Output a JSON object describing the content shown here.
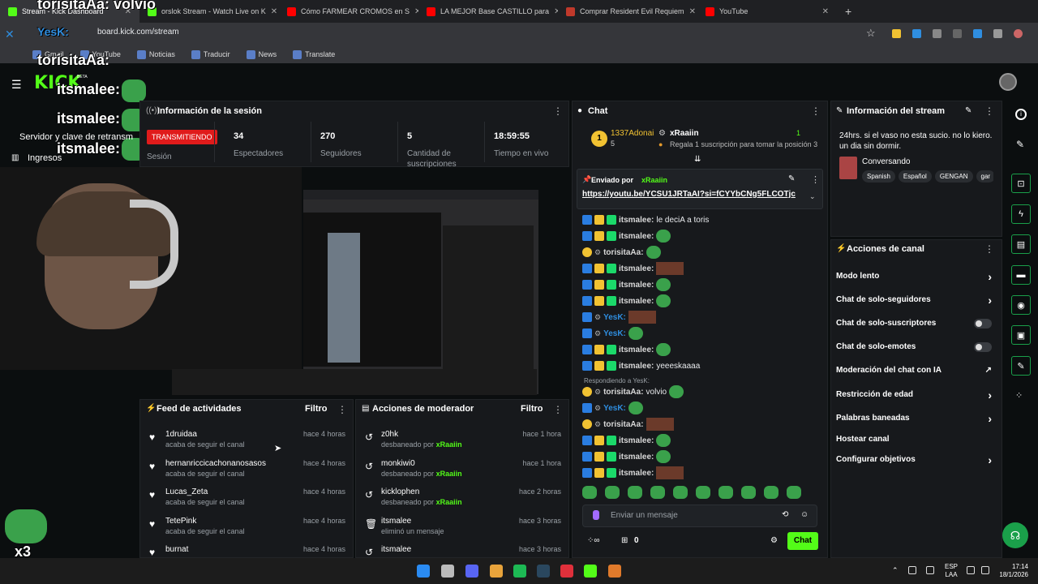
{
  "browser": {
    "tabs": [
      {
        "label": "Stream - Kick Dashboard",
        "color": "#53fc18",
        "active": true
      },
      {
        "label": "orslok Stream - Watch Live on K",
        "color": "#53fc18"
      },
      {
        "label": "Cómo FARMEAR CROMOS en S",
        "color": "#ff0000"
      },
      {
        "label": "LA MEJOR Base CASTILLO para",
        "color": "#ff0000"
      },
      {
        "label": "Comprar Resident Evil Requiem",
        "color": "#c0392b"
      },
      {
        "label": "YouTube",
        "color": "#ff0000"
      }
    ],
    "url": "board.kick.com/stream",
    "bookmarks": [
      "Gmail",
      "YouTube",
      "Noticias",
      "Traducir",
      "News",
      "Translate"
    ]
  },
  "overlay": {
    "name1": "torisitaAa: volvio",
    "name2": "torisitaAa:",
    "name3": "itsmalee:",
    "name4": "itsmalee:",
    "name5": "itsmalee:",
    "yesk": "YesK:",
    "kick": "KICK",
    "beta": "BETA",
    "menu_server": "Servidor y clave de retransm",
    "menu_income": "Ingresos",
    "x3": "x3"
  },
  "session": {
    "title": "Información de la sesión",
    "status": "TRANSMITIENDO",
    "status_label": "Sesión",
    "stats": [
      {
        "value": "34",
        "label": "Espectadores"
      },
      {
        "value": "270",
        "label": "Seguidores"
      },
      {
        "value": "5",
        "label": "Cantidad de suscripciones"
      },
      {
        "value": "18:59:55",
        "label": "Tiempo en vivo"
      }
    ]
  },
  "activity": {
    "title": "Feed de actividades",
    "filter": "Filtro",
    "rows": [
      {
        "name": "1druidaa",
        "sub": "acaba de seguir el canal",
        "time": "hace 4 horas"
      },
      {
        "name": "hernanriccicachonanosasos",
        "sub": "acaba de seguir el canal",
        "time": "hace 4 horas"
      },
      {
        "name": "Lucas_Zeta",
        "sub": "acaba de seguir el canal",
        "time": "hace 4 horas"
      },
      {
        "name": "TetePink",
        "sub": "acaba de seguir el canal",
        "time": "hace 4 horas"
      },
      {
        "name": "burnat",
        "sub": "",
        "time": "hace 4 horas"
      }
    ]
  },
  "moderator": {
    "title": "Acciones de moderador",
    "filter": "Filtro",
    "rows": [
      {
        "name": "z0hk",
        "sub": "desbaneado por",
        "by": "xRaaiin",
        "time": "hace 1 hora"
      },
      {
        "name": "monkiwi0",
        "sub": "desbaneado por",
        "by": "xRaaiin",
        "time": "hace 1 hora"
      },
      {
        "name": "kicklophen",
        "sub": "desbaneado por",
        "by": "xRaaiin",
        "time": "hace 2 horas"
      },
      {
        "name": "itsmalee",
        "sub": "eliminó un mensaje",
        "by": "",
        "time": "hace 3 horas"
      },
      {
        "name": "itsmalee",
        "sub": "",
        "by": "",
        "time": "hace 3 horas"
      }
    ]
  },
  "chat": {
    "title": "Chat",
    "leader1": "1337Adonai",
    "leader1_count": "5",
    "leader2": "xRaaiin",
    "leader2_count": "1",
    "gift_text": "Regala 1 suscripción para tomar la posición 3",
    "pinned_by": "Enviado por",
    "pinned_user": "xRaaiin",
    "pinned_link": "https://youtu.be/YCSU1JRTaAI?si=fCYYbCNg5FLCOTjc",
    "replying": "Respondiendo a YesK:",
    "messages": [
      {
        "user": "itsmalee:",
        "text": "le deciA a toris",
        "ucolor": "#d8d8d8"
      },
      {
        "user": "itsmalee:",
        "text": "",
        "ucolor": "#d8d8d8"
      },
      {
        "user": "torisitaAa:",
        "text": "",
        "ucolor": "#d8d8d8"
      },
      {
        "user": "itsmalee:",
        "text": "",
        "ucolor": "#d8d8d8"
      },
      {
        "user": "itsmalee:",
        "text": "",
        "ucolor": "#d8d8d8"
      },
      {
        "user": "itsmalee:",
        "text": "",
        "ucolor": "#d8d8d8"
      },
      {
        "user": "YesK:",
        "text": "",
        "ucolor": "#2f8ee0"
      },
      {
        "user": "YesK:",
        "text": "",
        "ucolor": "#2f8ee0"
      },
      {
        "user": "itsmalee:",
        "text": "",
        "ucolor": "#d8d8d8"
      },
      {
        "user": "itsmalee:",
        "text": "yeeeskaaaa",
        "ucolor": "#d8d8d8"
      },
      {
        "user": "torisitaAa:",
        "text": "volvio",
        "ucolor": "#d8d8d8"
      },
      {
        "user": "YesK:",
        "text": "",
        "ucolor": "#2f8ee0"
      },
      {
        "user": "torisitaAa:",
        "text": "",
        "ucolor": "#d8d8d8"
      },
      {
        "user": "itsmalee:",
        "text": "",
        "ucolor": "#d8d8d8"
      },
      {
        "user": "itsmalee:",
        "text": "",
        "ucolor": "#d8d8d8"
      },
      {
        "user": "itsmalee:",
        "text": "",
        "ucolor": "#d8d8d8"
      }
    ],
    "input_placeholder": "Enviar un mensaje",
    "points": "0",
    "send": "Chat"
  },
  "stream_info": {
    "title": "Información del stream",
    "description": "24hrs. si el vaso no esta sucio. no lo kiero. un dia sin dormir.",
    "category": "Conversando",
    "tags": [
      "Spanish",
      "Español",
      "GENGAN",
      "gar"
    ]
  },
  "channel_actions": {
    "title": "Acciones de canal",
    "items": [
      {
        "label": "Modo lento",
        "kind": "chevron"
      },
      {
        "label": "Chat de solo-seguidores",
        "kind": "chevron"
      },
      {
        "label": "Chat de solo-suscriptores",
        "kind": "toggle"
      },
      {
        "label": "Chat de solo-emotes",
        "kind": "toggle"
      },
      {
        "label": "Moderación del chat con IA",
        "kind": "external"
      },
      {
        "label": "Restricción de edad",
        "kind": "chevron"
      },
      {
        "label": "Palabras baneadas",
        "kind": "chevron"
      },
      {
        "label": "Hostear canal",
        "kind": "none"
      },
      {
        "label": "Configurar objetivos",
        "kind": "chevron"
      }
    ]
  },
  "taskbar": {
    "lang": "ESP",
    "lang2": "LAA",
    "time": "17:14",
    "date": "18/1/2026"
  }
}
